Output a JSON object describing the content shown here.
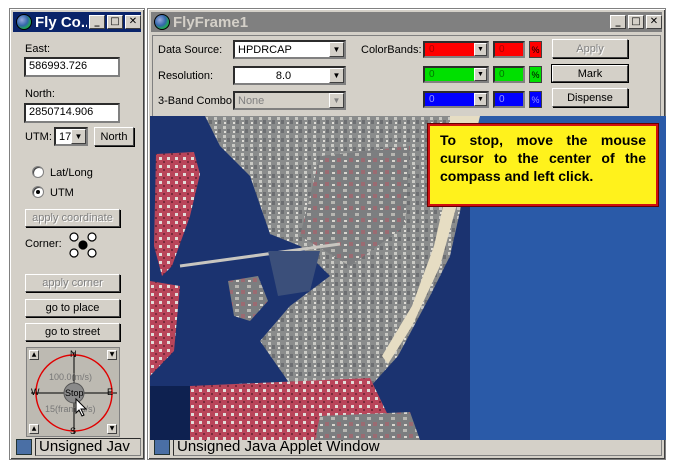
{
  "left_window": {
    "title": "Fly Co...",
    "east_label": "East:",
    "east_value": "586993.726",
    "north_label": "North:",
    "north_value": "2850714.906",
    "utm_label": "UTM:",
    "utm_zone": "17",
    "north_button": "North",
    "latlong_label": "Lat/Long",
    "utm_radio_label": "UTM",
    "apply_coordinate": "apply coordinate",
    "corner_label": "Corner:",
    "apply_corner": "apply corner",
    "go_to_place": "go to place",
    "go_to_street": "go to street",
    "compass": {
      "n": "N",
      "s": "S",
      "e": "E",
      "w": "W",
      "speed": "100.0(m/s)",
      "stop": "Stop",
      "frames": "15(frames/s)"
    },
    "status_text": "Unsigned Jav"
  },
  "main_window": {
    "title": "FlyFrame1",
    "data_source_label": "Data Source:",
    "data_source_value": "HPDRCAP",
    "resolution_label": "Resolution:",
    "resolution_value": "8.0",
    "combo_label": "3-Band Combo:",
    "combo_value": "None",
    "colorbands_label": "ColorBands:",
    "bands": [
      {
        "name": "red",
        "value1": "0",
        "value2": "0",
        "pct": "%",
        "color": "#ff0000"
      },
      {
        "name": "green",
        "value1": "0",
        "value2": "0",
        "pct": "%",
        "color": "#00e000"
      },
      {
        "name": "blue",
        "value1": "0",
        "value2": "0",
        "pct": "%",
        "color": "#0000ff"
      }
    ],
    "apply_button": "Apply",
    "mark_button": "Mark",
    "dispense_button": "Dispense",
    "tooltip": "To stop, move the mouse cursor to the center of the compass and left click.",
    "status_text": "Unsigned Java Applet Window"
  }
}
